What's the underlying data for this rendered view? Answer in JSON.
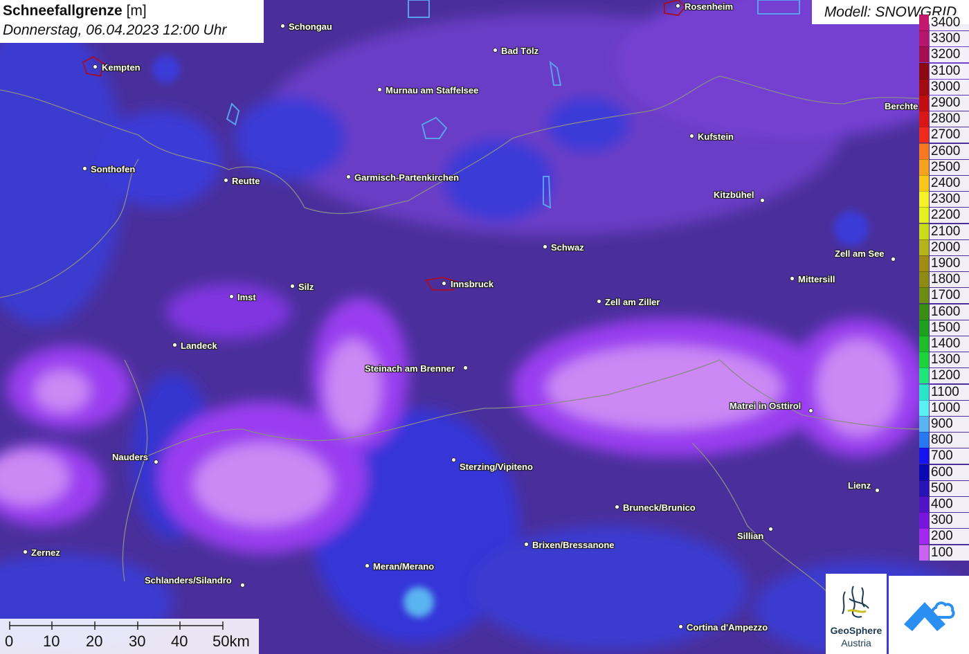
{
  "title": {
    "label": "Schneefallgrenze",
    "unit": "[m]",
    "datetime": "Donnerstag, 06.04.2023 12:00 Uhr"
  },
  "model": "Modell: SNOWGRID",
  "cities": [
    {
      "name": "Rosenheim"
    },
    {
      "name": "Schongau"
    },
    {
      "name": "Bad Tölz"
    },
    {
      "name": "Kempten"
    },
    {
      "name": "Murnau am Staffelsee"
    },
    {
      "name": "Berchte"
    },
    {
      "name": "Kufstein"
    },
    {
      "name": "Sonthofen"
    },
    {
      "name": "Reutte"
    },
    {
      "name": "Garmisch-Partenkirchen"
    },
    {
      "name": "Kitzbühel"
    },
    {
      "name": "Schwaz"
    },
    {
      "name": "Zell am See"
    },
    {
      "name": "Mittersill"
    },
    {
      "name": "Imst"
    },
    {
      "name": "Silz"
    },
    {
      "name": "Innsbruck"
    },
    {
      "name": "Zell am Ziller"
    },
    {
      "name": "Landeck"
    },
    {
      "name": "Steinach am Brenner"
    },
    {
      "name": "Matrei in Osttirol"
    },
    {
      "name": "Nauders"
    },
    {
      "name": "Sterzing/Vipiteno"
    },
    {
      "name": "Lienz"
    },
    {
      "name": "Bruneck/Brunico"
    },
    {
      "name": "Sillian"
    },
    {
      "name": "Brixen/Bressanone"
    },
    {
      "name": "Zernez"
    },
    {
      "name": "Meran/Merano"
    },
    {
      "name": "Schlanders/Silandro"
    },
    {
      "name": "Cortina d'Ampezzo"
    }
  ],
  "legend": {
    "items": [
      {
        "value": "3400",
        "color": "#c2186e"
      },
      {
        "value": "3300",
        "color": "#b5176a"
      },
      {
        "value": "3200",
        "color": "#a10f4d"
      },
      {
        "value": "3100",
        "color": "#8b0a12"
      },
      {
        "value": "3000",
        "color": "#a00d10"
      },
      {
        "value": "2900",
        "color": "#c10f10"
      },
      {
        "value": "2800",
        "color": "#d81818"
      },
      {
        "value": "2700",
        "color": "#f02a1a"
      },
      {
        "value": "2600",
        "color": "#f57a22"
      },
      {
        "value": "2500",
        "color": "#f5a21e"
      },
      {
        "value": "2400",
        "color": "#f7c81a"
      },
      {
        "value": "2300",
        "color": "#f5f02a"
      },
      {
        "value": "2200",
        "color": "#e4f020"
      },
      {
        "value": "2100",
        "color": "#c8dc1a"
      },
      {
        "value": "2000",
        "color": "#b4b41a"
      },
      {
        "value": "1900",
        "color": "#a08c14"
      },
      {
        "value": "1800",
        "color": "#8c8c14"
      },
      {
        "value": "1700",
        "color": "#6c8c14"
      },
      {
        "value": "1600",
        "color": "#3c8c14"
      },
      {
        "value": "1500",
        "color": "#1ea01e"
      },
      {
        "value": "1400",
        "color": "#1ebe2a"
      },
      {
        "value": "1300",
        "color": "#1ed23c"
      },
      {
        "value": "1200",
        "color": "#1ee678"
      },
      {
        "value": "1100",
        "color": "#2ae6c8"
      },
      {
        "value": "1000",
        "color": "#5af0f0"
      },
      {
        "value": "900",
        "color": "#5ab4f0"
      },
      {
        "value": "800",
        "color": "#2a78f0"
      },
      {
        "value": "700",
        "color": "#1414f0"
      },
      {
        "value": "600",
        "color": "#0a0ab4"
      },
      {
        "value": "500",
        "color": "#2814b4"
      },
      {
        "value": "400",
        "color": "#5014c8"
      },
      {
        "value": "300",
        "color": "#7814dc"
      },
      {
        "value": "200",
        "color": "#a028f0"
      },
      {
        "value": "100",
        "color": "#c864f0"
      }
    ]
  },
  "scale": {
    "labels": [
      "0",
      "10",
      "20",
      "30",
      "40",
      "50km"
    ]
  },
  "logos": {
    "geosphere_line1": "GeoSphere",
    "geosphere_line2": "Austria"
  }
}
